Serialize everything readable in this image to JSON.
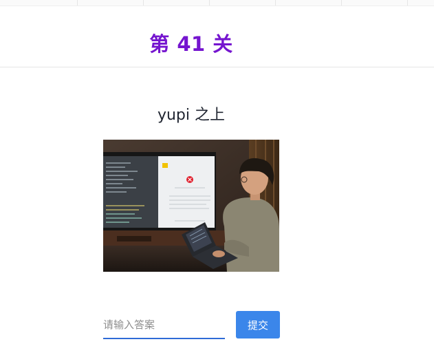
{
  "header": {
    "level_title": "第 41 关"
  },
  "puzzle": {
    "title": "yupi 之上",
    "image_alt": "Developer looking at a large TV screen showing code and an error dialog, with a laptop on his lap"
  },
  "answer": {
    "placeholder": "请输入答案",
    "value": ""
  },
  "submit": {
    "label": "提交"
  },
  "colors": {
    "accent": "#7515cf",
    "button": "#3b86ea",
    "input_underline": "#2e6bd6"
  }
}
